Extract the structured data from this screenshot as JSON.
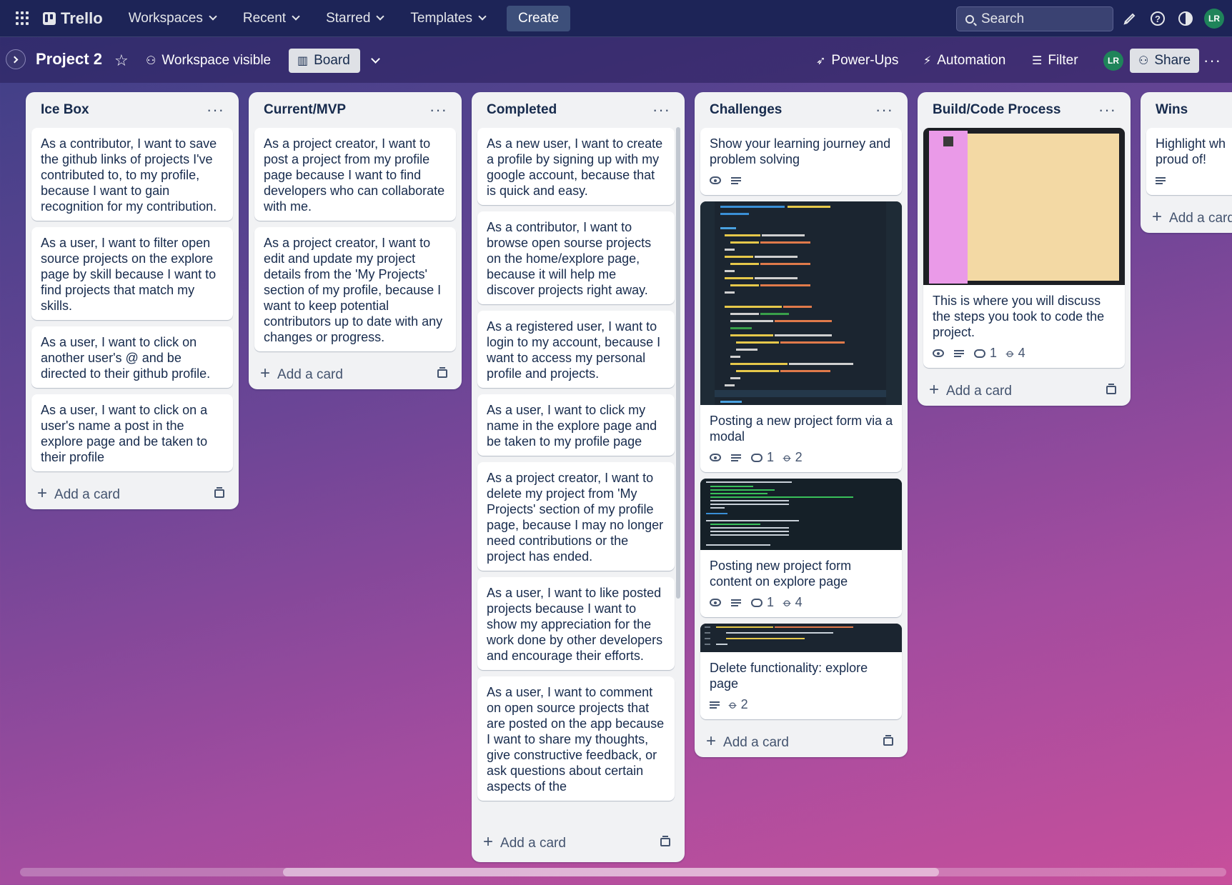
{
  "nav": {
    "logo": "Trello",
    "menus": [
      "Workspaces",
      "Recent",
      "Starred",
      "Templates"
    ],
    "create": "Create",
    "search_placeholder": "Search",
    "avatar": "LR"
  },
  "board": {
    "title": "Project 2",
    "visibility": "Workspace visible",
    "view": "Board",
    "powerups": "Power-Ups",
    "automation": "Automation",
    "filter": "Filter",
    "member_avatar": "LR",
    "share": "Share"
  },
  "add_card_label": "Add a card",
  "lists": {
    "icebox": {
      "title": "Ice Box",
      "cards": [
        "As a contributor, I want to save the github links of projects I've contributed to, to my profile, because I want to gain recognition for my contribution.",
        "As a user, I want to filter open source projects on the explore page by skill because I want to find projects that match my skills.",
        "As a user, I want to click on another user's @ and be directed to their github profile.",
        "As a user, I want to click on a user's name a post in the explore page and be taken to their profile"
      ]
    },
    "mvp": {
      "title": "Current/MVP",
      "cards": [
        "As a project creator, I want to post a project from my profile page because I want to find developers who can collaborate with me.",
        "As a project creator, I want to edit and update my project details from the 'My Projects' section of my profile, because I want to keep potential contributors up to date with any changes or progress."
      ]
    },
    "completed": {
      "title": "Completed",
      "cards": [
        "As a new user, I want to create a profile by signing up with my google account, because that is quick and easy.",
        "As a contributor, I want to browse open sourse projects on the home/explore page, because it will help me discover projects right away.",
        "As a registered user, I want to login to my account, because I want to access my personal profile and projects.",
        "As a user, I want to click my name in the explore page and be taken to my profile page",
        "As a project creator, I want to delete my project from 'My Projects' section of my profile page, because I may no longer need contributions or the project has ended.",
        "As a user, I want to like posted projects because I want to show my appreciation for the work done by other developers and encourage their efforts.",
        "As a user, I want to comment on open source projects that are posted on the app because I want to share my thoughts, give constructive feedback, or ask questions about certain aspects of the"
      ]
    },
    "challenges": {
      "title": "Challenges",
      "cards": [
        {
          "text": "Show your learning journey and problem solving"
        },
        {
          "text": "Posting a new project form via a modal",
          "comments": "1",
          "attachments": "2"
        },
        {
          "text": "Posting new project form content on explore page",
          "comments": "1",
          "attachments": "4"
        },
        {
          "text": "Delete functionality: explore page",
          "attachments": "2"
        }
      ]
    },
    "build": {
      "title": "Build/Code Process",
      "cards": [
        {
          "text": "This is where you will discuss the steps you took to code the project.",
          "comments": "1",
          "attachments": "4"
        }
      ]
    },
    "wins": {
      "title": "Wins",
      "cards": [
        "Highlight wh proud of!"
      ]
    }
  },
  "colors": {
    "nav_bg": "#1d2457",
    "list_bg": "#f1f2f4",
    "avatar": "#1f845a",
    "code_bg": "#1e2b36"
  }
}
